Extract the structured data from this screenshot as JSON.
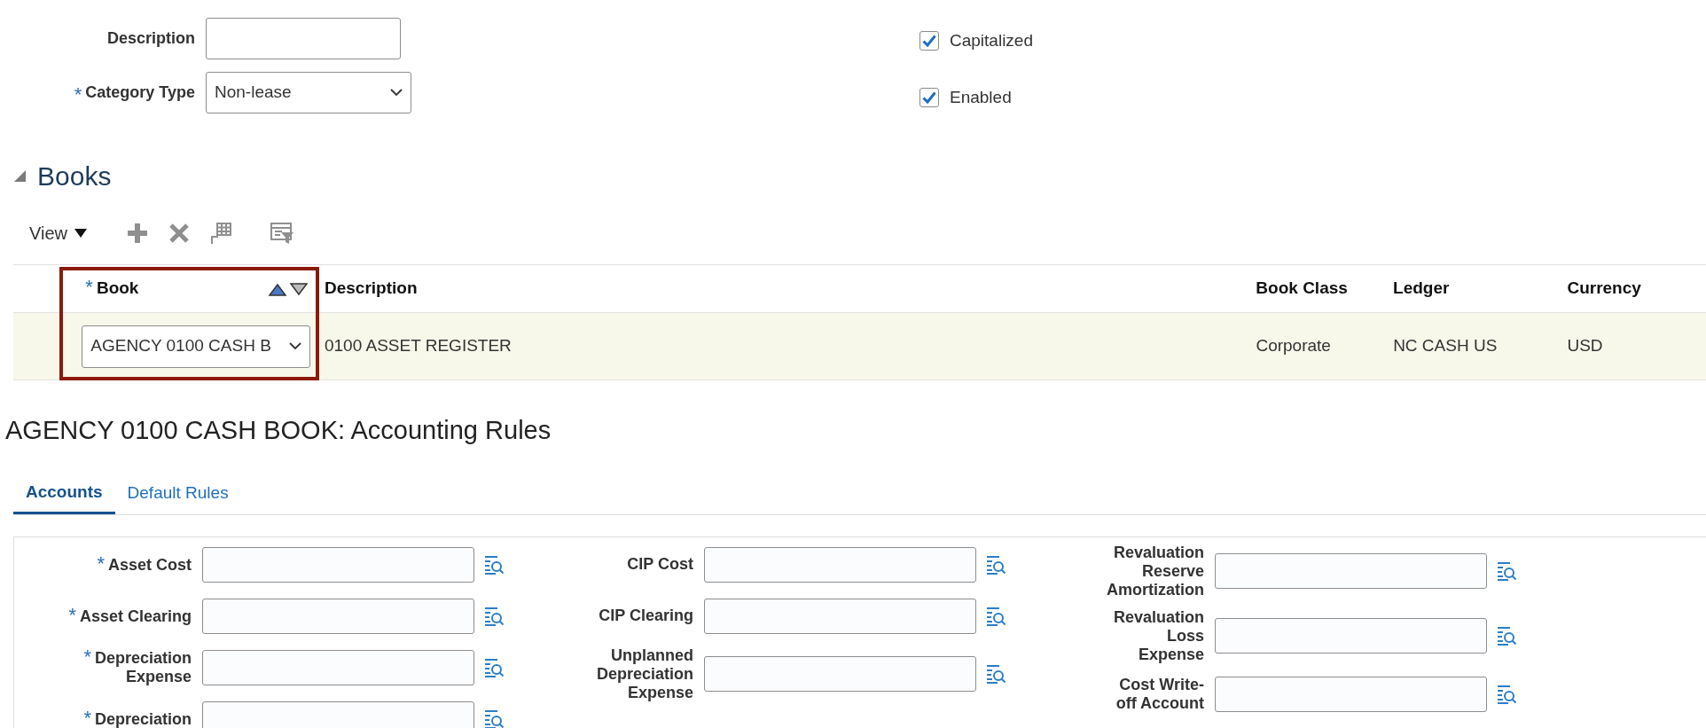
{
  "header_fields": [
    {
      "kind": "text",
      "label": "Description"
    },
    {
      "kind": "select",
      "label": "Category Type",
      "marker": "*",
      "value": "Non-lease"
    }
  ],
  "checkboxes": [
    {
      "label": "Capitalized",
      "checked": true
    },
    {
      "label": "Enabled",
      "checked": true
    }
  ],
  "books": {
    "title": "Books",
    "expanded": true,
    "view_label": "View",
    "columns": [
      {
        "label": "Book",
        "marker": "*",
        "sorted": true,
        "highlighted": true
      },
      {
        "label": "Description",
        "sorted": false,
        "highlighted": false
      },
      {
        "label": "Book Class",
        "sorted": false,
        "highlighted": false
      },
      {
        "label": "Ledger",
        "sorted": false,
        "highlighted": false
      },
      {
        "label": "Currency",
        "sorted": false,
        "highlighted": false
      }
    ],
    "rows": [
      {
        "selected": true,
        "cells": [
          "AGENCY 0100 CASH B",
          "0100 ASSET REGISTER",
          "Corporate",
          "NC CASH US",
          "USD"
        ]
      }
    ]
  },
  "accounting_rules": {
    "title": "AGENCY 0100 CASH BOOK: Accounting Rules",
    "tabs": [
      {
        "label": "Accounts",
        "selected": true
      },
      {
        "label": "Default Rules",
        "selected": false
      }
    ],
    "field_columns": [
      [
        {
          "label": "Asset Cost",
          "marker": "*"
        },
        {
          "label": "Asset Clearing",
          "marker": "*"
        },
        {
          "label": "Depreciation Expense",
          "marker": "*"
        },
        {
          "label": "Depreciation",
          "marker": "*"
        }
      ],
      [
        {
          "label": "CIP Cost"
        },
        {
          "label": "CIP Clearing"
        },
        {
          "label": "Unplanned Depreciation Expense"
        }
      ],
      [
        {
          "label": "Revaluation Reserve Amortization"
        },
        {
          "label": "Revaluation Loss Expense"
        },
        {
          "label": "Cost Write-off Account"
        }
      ]
    ]
  }
}
